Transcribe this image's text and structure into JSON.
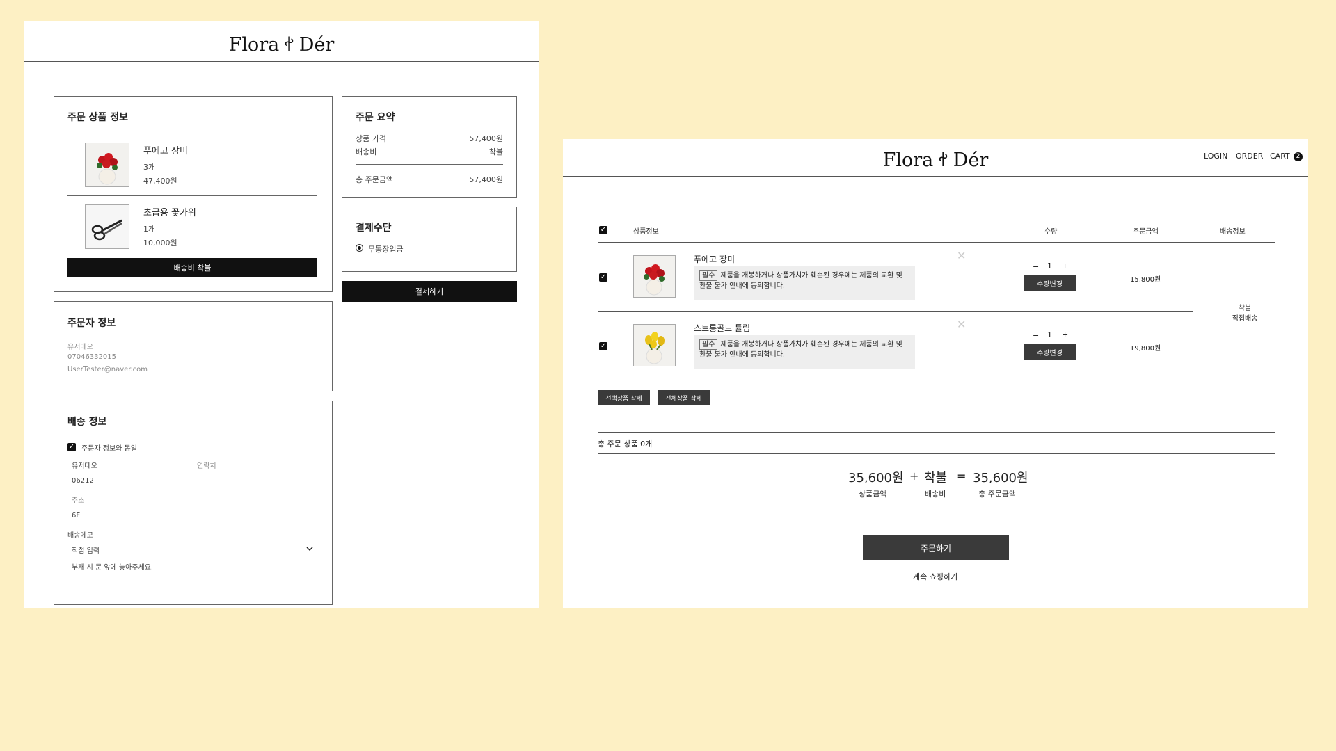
{
  "brand": "Flora ꬷ Dér",
  "checkout": {
    "order_items_title": "주문 상품 정보",
    "items": [
      {
        "name": "푸에고 장미",
        "qty": "3개",
        "price": "47,400원",
        "image_icon": "red-rose-vase-image"
      },
      {
        "name": "초급용 꽃가위",
        "qty": "1개",
        "price": "10,000원",
        "image_icon": "flower-scissors-image"
      }
    ],
    "shipping_free_label": "배송비 착불",
    "summary_title": "주문 요약",
    "summary_rows": [
      {
        "label": "상품 가격",
        "value": "57,400원"
      },
      {
        "label": "배송비",
        "value": "착불"
      }
    ],
    "summary_total_label": "총 주문금액",
    "summary_total_value": "57,400원",
    "payment_title": "결제수단",
    "payment_option": "무통장입금",
    "pay_button": "결제하기",
    "orderer_title": "주문자 정보",
    "orderer_name": "유저테오",
    "orderer_phone": "07046332015",
    "orderer_email": "UserTester@naver.com",
    "delivery_title": "배송 정보",
    "same_as_orderer": "주문자 정보와 동일",
    "recipient_name": "유저테오",
    "contact_placeholder": "연락처",
    "postcode": "06212",
    "address_placeholder": "주소",
    "address_detail": "6F",
    "memo_label": "배송메모",
    "memo_select": "직접 입력",
    "memo_text": "부재 시 문 앞에 놓아주세요."
  },
  "cart": {
    "nav": [
      "LOGIN",
      "ORDER",
      "CART"
    ],
    "cart_count": "2",
    "headers": {
      "info": "상품정보",
      "qty": "수량",
      "amount": "주문금액",
      "delivery": "배송정보"
    },
    "items": [
      {
        "name": "푸에고 장미",
        "notice_tag": "필수",
        "notice": "제품을 개봉하거나 상품가치가 훼손된 경우에는 제품의 교환 및 환불 불가 안내에 동의합니다.",
        "qty": "1",
        "change_btn": "수량변경",
        "amount": "15,800원",
        "image_icon": "red-rose-vase-image"
      },
      {
        "name": "스트롱골드 튤립",
        "notice_tag": "필수",
        "notice": "제품을 개봉하거나 상품가치가 훼손된 경우에는 제품의 교환 및 환불 불가 안내에 동의합니다.",
        "qty": "1",
        "change_btn": "수량변경",
        "amount": "19,800원",
        "image_icon": "yellow-tulip-vase-image"
      }
    ],
    "delivery_info_1": "착불",
    "delivery_info_2": "직접배송",
    "delete_selected": "선택상품 삭제",
    "delete_all": "전체상품 삭제",
    "total_count_label": "총 주문 상품 0개",
    "sum": {
      "product": "35,600원",
      "product_cap": "상품금액",
      "plus": "+",
      "ship": "착불",
      "ship_cap": "배송비",
      "equals": "=",
      "total": "35,600원",
      "total_cap": "총 주문금액"
    },
    "order_button": "주문하기",
    "continue_link": "계속 쇼핑하기"
  }
}
